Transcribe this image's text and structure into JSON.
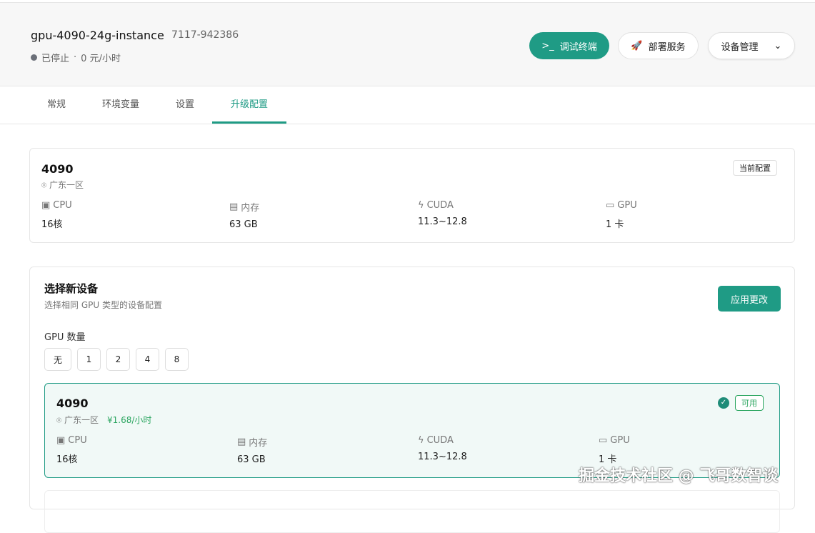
{
  "header": {
    "title": "gpu-4090-24g-instance",
    "instance_id": "7117-942386",
    "status": "已停止",
    "price": "0 元/小时",
    "separator": "·",
    "buttons": {
      "terminal": "调试终端",
      "deploy": "部署服务",
      "manage": "设备管理"
    }
  },
  "tabs": [
    "常规",
    "环境变量",
    "设置",
    "升级配置"
  ],
  "current": {
    "name": "4090",
    "location": "广东一区",
    "badge": "当前配置",
    "specs": [
      {
        "label": "CPU",
        "value": "16核"
      },
      {
        "label": "内存",
        "value": "63 GB"
      },
      {
        "label": "CUDA",
        "value": "11.3~12.8"
      },
      {
        "label": "GPU",
        "value": "1 卡"
      }
    ]
  },
  "select": {
    "title": "选择新设备",
    "subtitle": "选择相同 GPU 类型的设备配置",
    "apply": "应用更改",
    "gpu_count_label": "GPU 数量",
    "counts": [
      "无",
      "1",
      "2",
      "4",
      "8"
    ],
    "option": {
      "name": "4090",
      "location": "广东一区",
      "price": "¥1.68/小时",
      "badge": "可用",
      "specs": [
        {
          "label": "CPU",
          "value": "16核"
        },
        {
          "label": "内存",
          "value": "63 GB"
        },
        {
          "label": "CUDA",
          "value": "11.3~12.8"
        },
        {
          "label": "GPU",
          "value": "1 卡"
        }
      ]
    }
  },
  "watermark": "掘金技术社区 @ 飞哥数智谈"
}
